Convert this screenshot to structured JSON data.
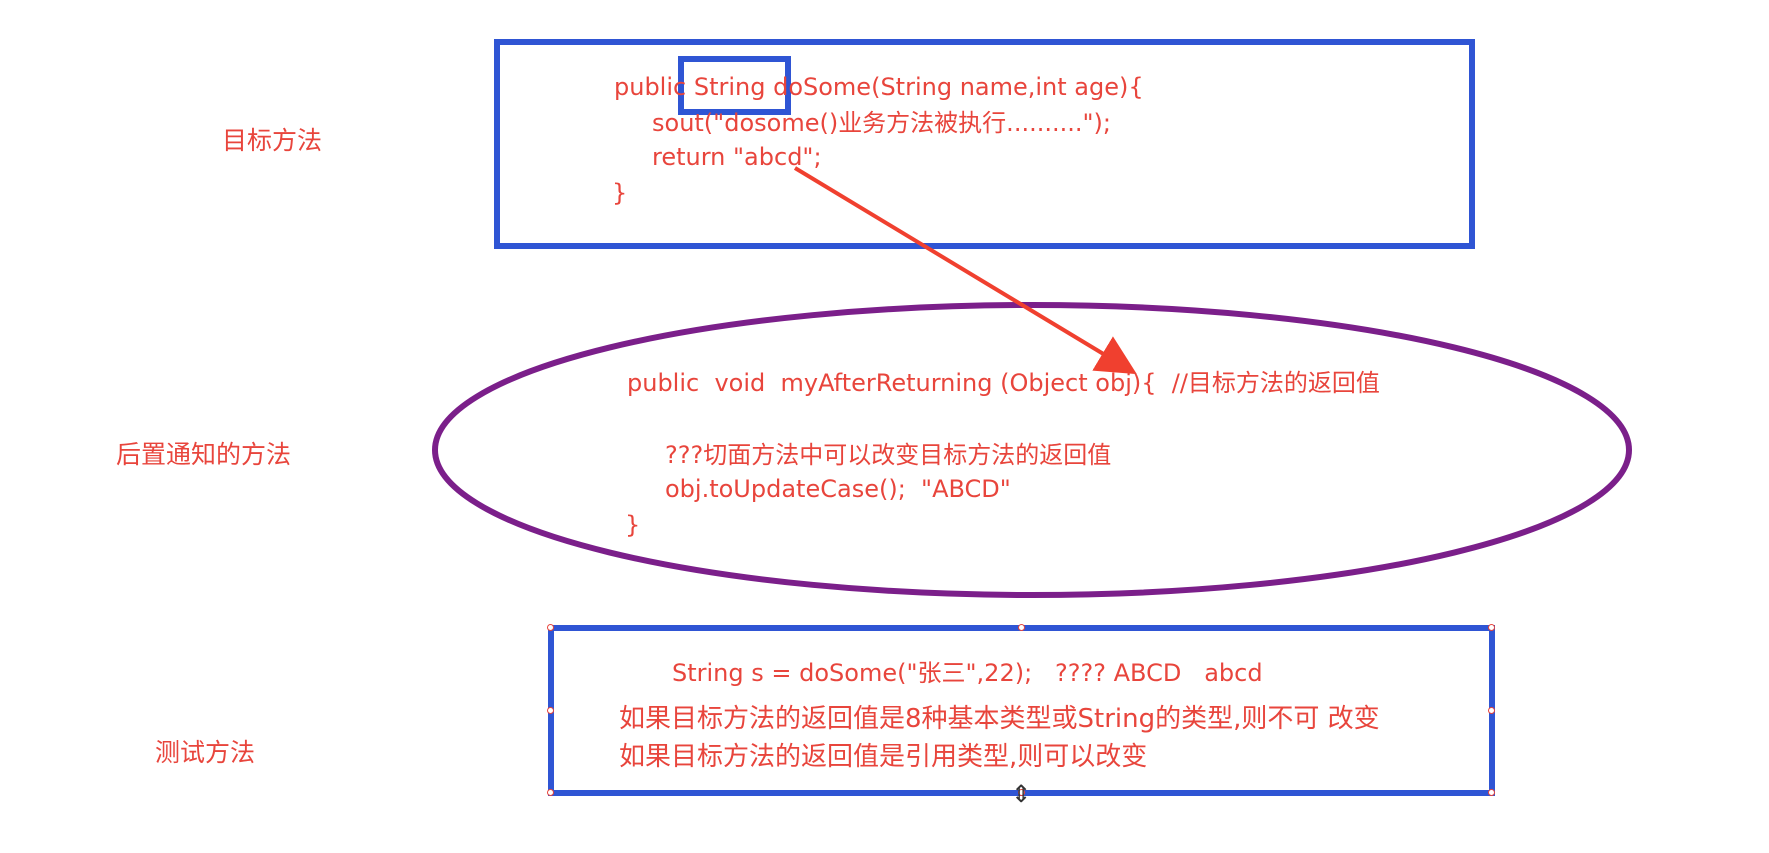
{
  "labels": {
    "target_method": "目标方法",
    "after_advice_method": "后置通知的方法",
    "test_method": "测试方法"
  },
  "target_box": {
    "line1": "public String doSome(String name,int age){",
    "line2": "sout(\"dosome()业务方法被执行..........\");",
    "line3": "return \"abcd\";",
    "line4": "}"
  },
  "advice_ellipse": {
    "line1": "public  void  myAfterReturning (Object obj){  //目标方法的返回值",
    "line2": "???切面方法中可以改变目标方法的返回值",
    "line3": "obj.toUpdateCase();  \"ABCD\"",
    "line4": "}"
  },
  "test_box": {
    "line1": "String s = doSome(\"张三\",22);   ???? ABCD   abcd",
    "line2": "如果目标方法的返回值是8种基本类型或String的类型,则不可 改变",
    "line3": "如果目标方法的返回值是引用类型,则可以改变"
  },
  "colors": {
    "text_red": "#e8453c",
    "box_blue": "#2f55d4",
    "ellipse_purple": "#7b1f8a",
    "arrow_red": "#f0402f"
  }
}
